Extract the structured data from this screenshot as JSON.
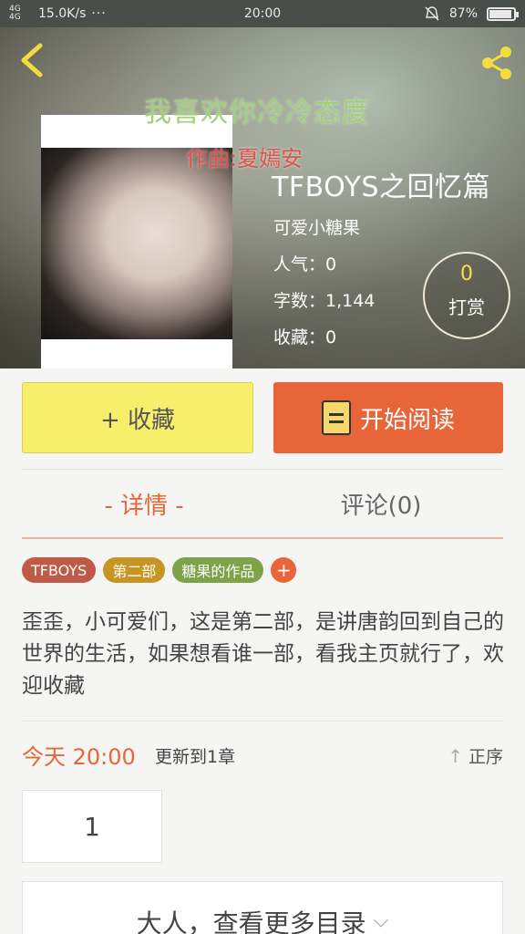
{
  "status_bar": {
    "signal": "4G 4G",
    "net_speed": "15.0K/s",
    "dots": "···",
    "time": "20:00",
    "battery": "87%",
    "battery_level": 0.87,
    "icons": [
      "signal-icon",
      "mute-icon",
      "battery-icon"
    ]
  },
  "header": {
    "back_icon": "chevron-left-icon",
    "share_icon": "share-icon"
  },
  "cover": {
    "title": "我喜欢你冷冷态度",
    "subtitle": "作曲:夏嫣安"
  },
  "book": {
    "title": "TFBOYS之回忆篇",
    "author": "可爱小糖果",
    "popularity": "人气：0",
    "word_count": "字数：1,144",
    "favorites": "收藏：0",
    "tip_count": "0",
    "tip_label": "打赏"
  },
  "actions": {
    "favorite_label": "+ 收藏",
    "read_label": "开始阅读"
  },
  "tabs": [
    {
      "label": "- 详情 -"
    },
    {
      "label": "评论(0)"
    }
  ],
  "tags": [
    "TFBOYS",
    "第二部",
    "糖果的作品"
  ],
  "tag_add": "+",
  "description": "歪歪，小可爱们，这是第二部，是讲唐韵回到自己的世界的生活，如果想看谁一部，看我主页就行了，欢迎收藏",
  "update": {
    "time": "今天 20:00",
    "text": "更新到1章",
    "sort_label": "正序",
    "sort_icon": "arrow-up-icon"
  },
  "chapters": [
    "1"
  ],
  "more_label": "大人，查看更多目录",
  "colors": {
    "accent": "#e8653a",
    "favorite_button": "#f7ee6a",
    "tag_tfboys": "#c05a46",
    "tag_part2": "#c69524",
    "tag_works": "#7da247"
  }
}
